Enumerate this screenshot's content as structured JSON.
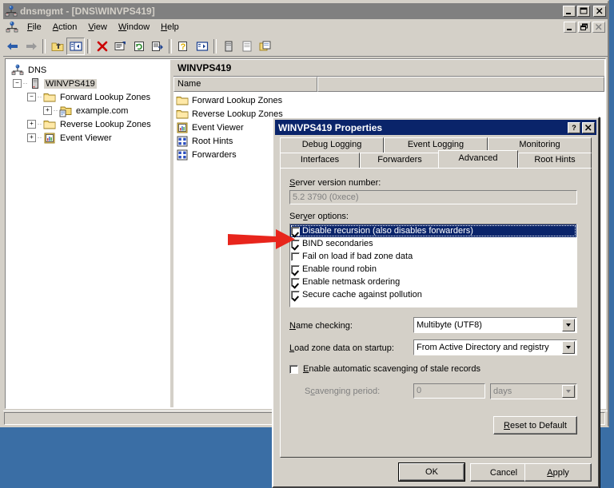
{
  "window": {
    "title": "dnsmgmt - [DNS\\WINVPS419]",
    "icon": "dns-server-icon",
    "buttons": {
      "minimize": "_",
      "maximize": "□",
      "close": "✕"
    }
  },
  "menubar": {
    "icon": "dns-server-icon",
    "items": [
      "File",
      "Action",
      "View",
      "Window",
      "Help"
    ],
    "mdi_buttons": {
      "minimize": "_",
      "restore": "❐",
      "close": "✕"
    }
  },
  "toolbar": {
    "items": [
      {
        "name": "back-icon"
      },
      {
        "name": "forward-icon"
      },
      {
        "name": "up-one-level-icon"
      },
      {
        "name": "show-hide-console-tree-icon"
      },
      {
        "name": "delete-icon"
      },
      {
        "name": "properties-icon"
      },
      {
        "name": "refresh-icon"
      },
      {
        "name": "export-list-icon"
      },
      {
        "name": "help-icon"
      },
      {
        "name": "new-window-icon"
      },
      {
        "name": "server-icon"
      },
      {
        "name": "list-icon"
      },
      {
        "name": "copy-icon"
      }
    ]
  },
  "tree": {
    "root": "DNS",
    "server": "WINVPS419",
    "nodes": [
      {
        "label": "Forward Lookup Zones",
        "icon": "folder-icon",
        "expander": "-"
      },
      {
        "label": "example.com",
        "icon": "zone-folder-icon",
        "expander": "+"
      },
      {
        "label": "Reverse Lookup Zones",
        "icon": "folder-icon",
        "expander": "+"
      },
      {
        "label": "Event Viewer",
        "icon": "event-viewer-icon",
        "expander": "+"
      }
    ]
  },
  "list_pane": {
    "header": "WINVPS419",
    "columns": [
      "Name",
      ""
    ],
    "rows": [
      {
        "name": "Forward Lookup Zones",
        "icon": "folder-icon"
      },
      {
        "name": "Reverse Lookup Zones",
        "icon": "folder-icon"
      },
      {
        "name": "Event Viewer",
        "icon": "event-viewer-icon"
      },
      {
        "name": "Root Hints",
        "icon": "root-hints-icon"
      },
      {
        "name": "Forwarders",
        "icon": "forwarders-icon"
      }
    ]
  },
  "dialog": {
    "title": "WINVPS419 Properties",
    "help_button": "?",
    "close_button": "✕",
    "tabs_row1": [
      "Debug Logging",
      "Event Logging",
      "Monitoring"
    ],
    "tabs_row2": [
      "Interfaces",
      "Forwarders",
      "Advanced",
      "Root Hints"
    ],
    "active_tab": "Advanced",
    "version_label": "Server version number:",
    "version_value": "5.2 3790 (0xece)",
    "options_label": "Server options:",
    "options": [
      {
        "label": "Disable recursion (also disables forwarders)",
        "checked": true,
        "selected": true
      },
      {
        "label": "BIND secondaries",
        "checked": true,
        "selected": false
      },
      {
        "label": "Fail on load if bad zone data",
        "checked": false,
        "selected": false
      },
      {
        "label": "Enable round robin",
        "checked": true,
        "selected": false
      },
      {
        "label": "Enable netmask ordering",
        "checked": true,
        "selected": false
      },
      {
        "label": "Secure cache against pollution",
        "checked": true,
        "selected": false
      }
    ],
    "name_checking_label": "Name checking:",
    "name_checking_value": "Multibyte (UTF8)",
    "load_zone_label": "Load zone data on startup:",
    "load_zone_value": "From Active Directory and registry",
    "scavenging_enable_label": "Enable automatic scavenging of stale records",
    "scavenging_enabled": false,
    "scavenging_period_label": "Scavenging period:",
    "scavenging_period_value": "0",
    "scavenging_unit_value": "days",
    "reset_button": "Reset to Default",
    "ok_button": "OK",
    "cancel_button": "Cancel",
    "apply_button": "Apply"
  },
  "annotation": {
    "name": "red-arrow-annotation",
    "color": "#e8251c",
    "points_at": "Disable recursion (also disables forwarders)"
  },
  "colors": {
    "desktop": "#3a6ea5",
    "face": "#d4d0c8",
    "inactive_title": "#808080",
    "dialog_title": "#0a246a",
    "selection": "#0a246a",
    "folder": "#f5d97a"
  }
}
